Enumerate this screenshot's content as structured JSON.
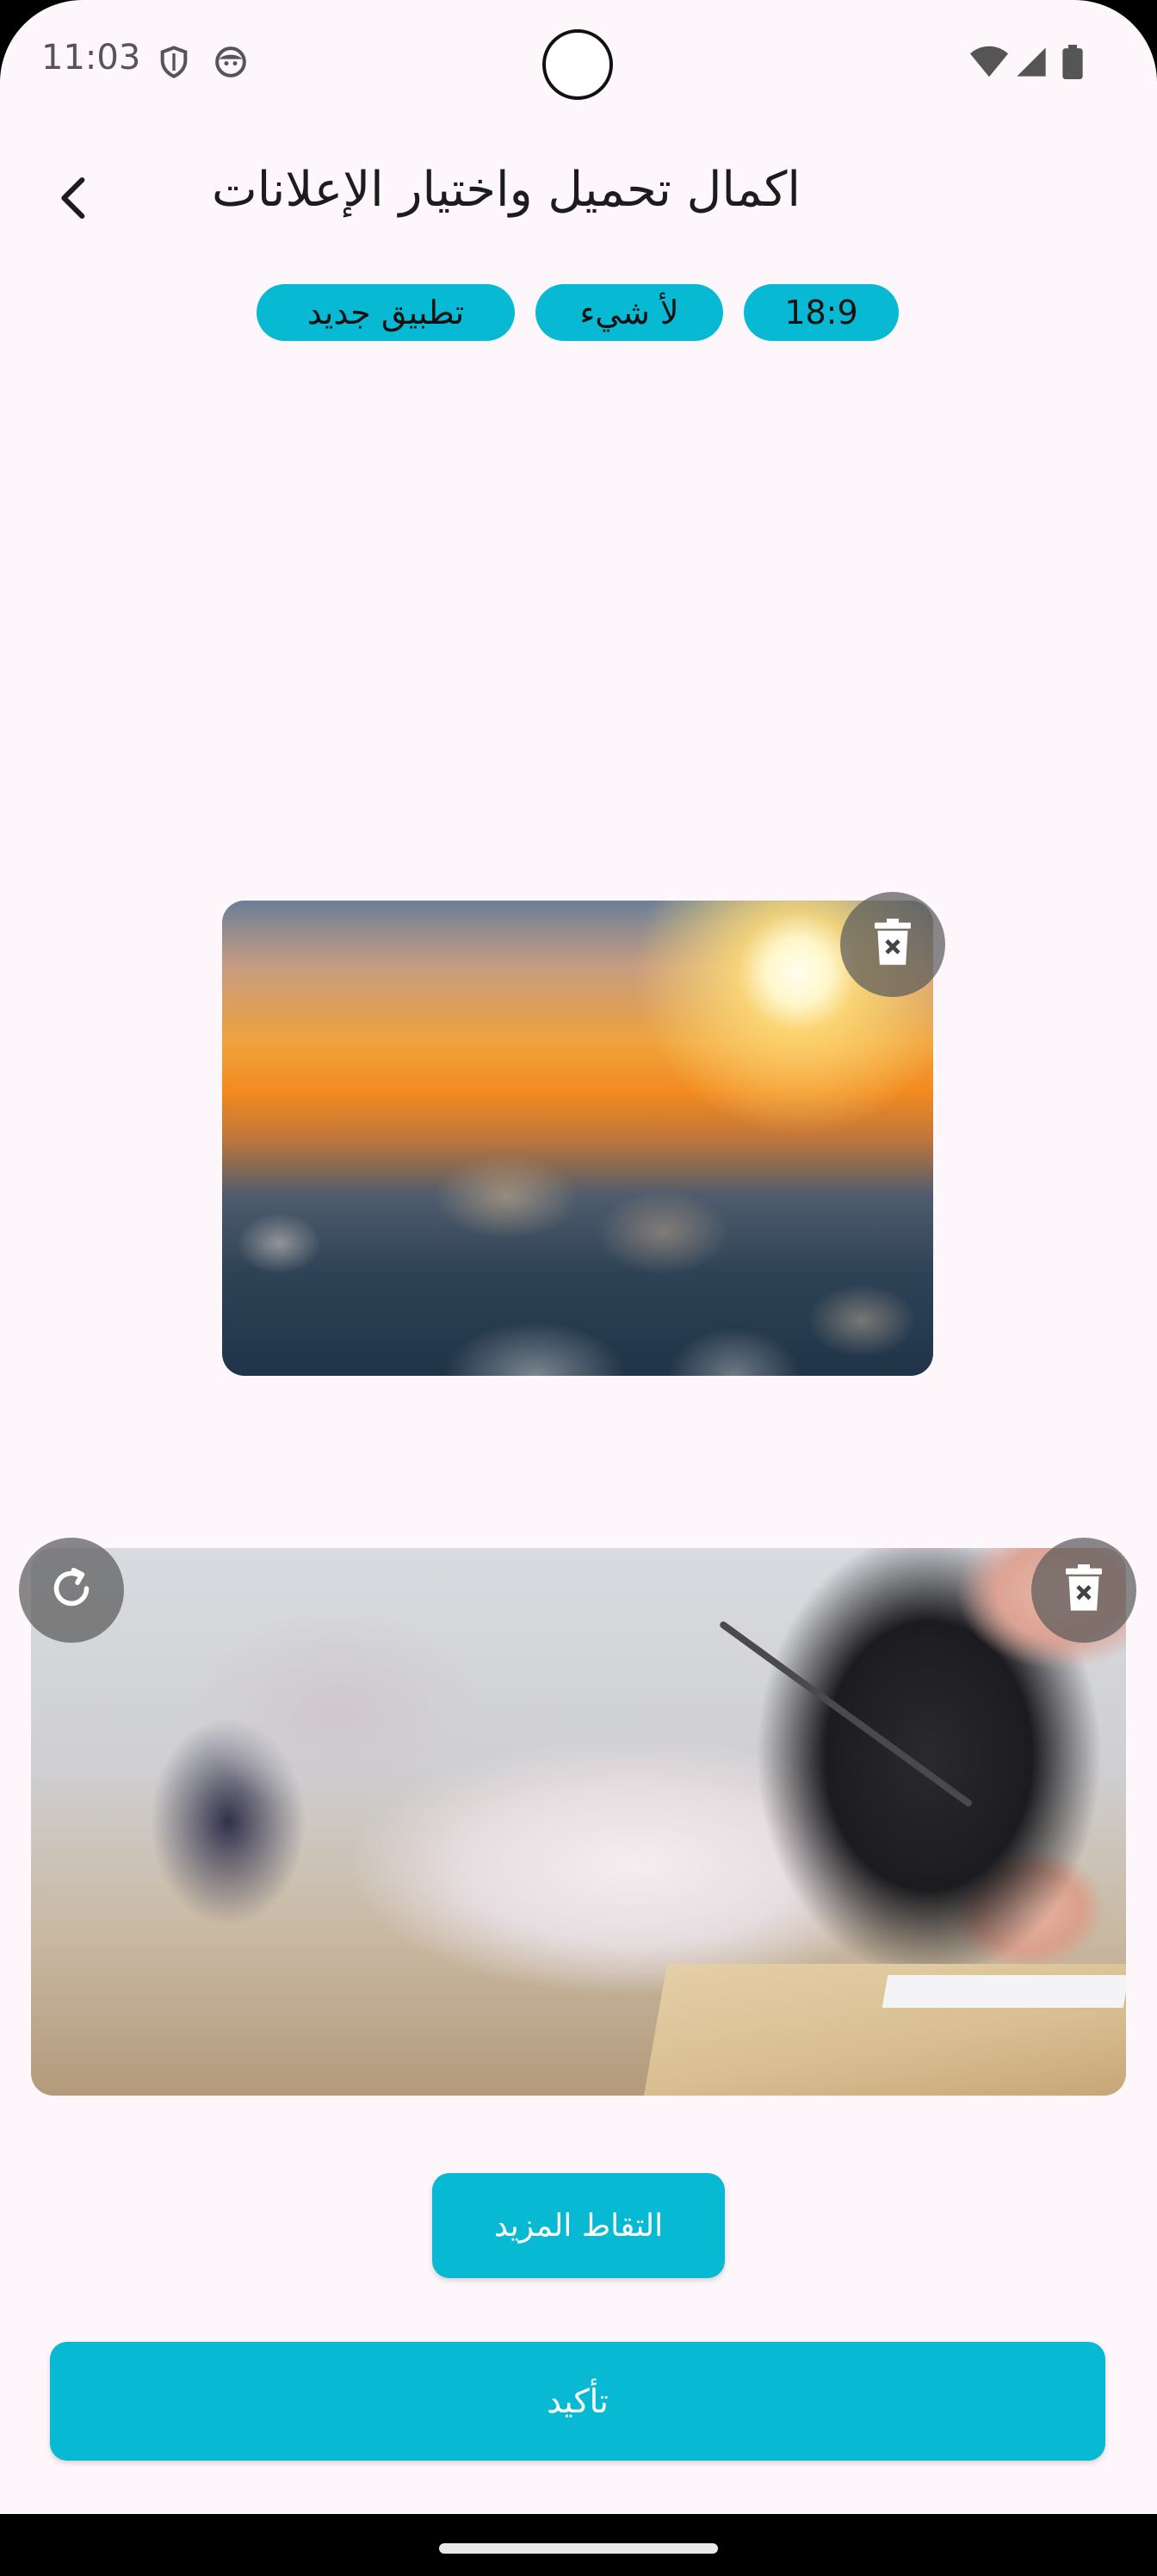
{
  "status_bar": {
    "time": "11:03",
    "left_icons": [
      "shield-icon",
      "face-icon"
    ],
    "right_icons": [
      "wifi-icon",
      "signal-icon",
      "battery-icon"
    ]
  },
  "header": {
    "back_icon": "arrow-back-icon",
    "title": "اكمال تحميل واختيار الإعلانات"
  },
  "chips": [
    {
      "label": "تطبيق جديد"
    },
    {
      "label": "لأ شيء"
    },
    {
      "label": "18:9"
    }
  ],
  "images": [
    {
      "name": "sunset-above-clouds",
      "actions": [
        "delete-icon"
      ]
    },
    {
      "name": "student-writing-exam",
      "actions": [
        "rotate-icon",
        "delete-icon"
      ]
    }
  ],
  "buttons": {
    "take_more": "التقاط المزيد",
    "confirm": "تأكيد"
  },
  "colors": {
    "accent": "#08b9d3",
    "background": "#fdf6fb",
    "title_text": "#1c1b1f"
  }
}
